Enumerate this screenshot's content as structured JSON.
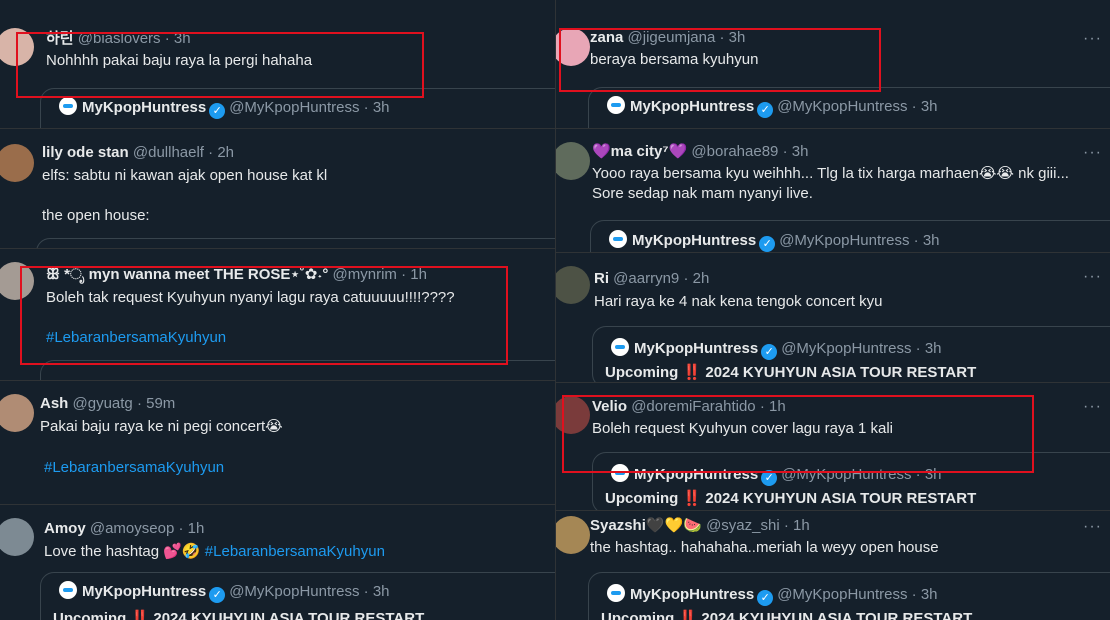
{
  "quoted_account": {
    "name": "MyKpopHuntress",
    "handle": "@MyKpopHuntress",
    "time": "3h",
    "snippet_pre": "Upcoming",
    "snippet_alarm": "‼️",
    "snippet_post": "2024 KYUHYUN ASIA TOUR RESTART"
  },
  "left_column": {
    "tweets": [
      {
        "name": "하린",
        "handle": "@biaslovers",
        "time": "3h",
        "line1": "Nohhhh pakai baju raya la pergi hahaha"
      },
      {
        "name": "lily ode stan",
        "handle": "@dullhaelf",
        "time": "2h",
        "line1": "elfs: sabtu ni kawan ajak open house kat kl",
        "line2": "the open house:"
      },
      {
        "name": "ꕥ *ೃ myn wanna meet THE ROSE⋆˚✿˖°",
        "handle": "@mynrim",
        "time": "1h",
        "line1": "Boleh tak request Kyuhyun nyanyi lagu raya catuuuuu!!!!????",
        "hashtag": "#LebaranbersamaKyuhyun"
      },
      {
        "name": "Ash",
        "handle": "@gyuatg",
        "time": "59m",
        "line1": "Pakai baju raya ke ni pegi concert😭",
        "hashtag": "#LebaranbersamaKyuhyun"
      },
      {
        "name": "Amoy",
        "handle": "@amoyseop",
        "time": "1h",
        "line1": "Love the hashtag 💕🤣",
        "hashtag": "#LebaranbersamaKyuhyun"
      }
    ]
  },
  "right_column": {
    "tweets": [
      {
        "name": "zana",
        "handle": "@jigeumjana",
        "time": "3h",
        "line1": "beraya bersama kyuhyun"
      },
      {
        "name": "💜ma city⁷💜",
        "handle": "@borahae89",
        "time": "3h",
        "line1": "Yooo raya bersama kyu weihhh... Tlg la tix harga marhaen😭😭 nk giii...",
        "line2": "Sore sedap nak mam nyanyi live."
      },
      {
        "name": "Ri",
        "handle": "@aarryn9",
        "time": "2h",
        "line1": "Hari raya ke 4 nak kena tengok concert kyu"
      },
      {
        "name": "Velio",
        "handle": "@doremiFarahtido",
        "time": "1h",
        "line1": "Boleh request Kyuhyun cover lagu raya 1 kali"
      },
      {
        "name": "Syazshi🖤💛🍉",
        "handle": "@syaz_shi",
        "time": "1h",
        "line1": "the hashtag.. hahahaha..meriah la weyy open house"
      }
    ]
  },
  "more_glyph": "···",
  "dot": "·",
  "verified_glyph": "✓",
  "colors": {
    "background": "#15202b",
    "accent": "#1d9bf0",
    "highlight": "#e0101e",
    "muted": "#8b98a5"
  }
}
